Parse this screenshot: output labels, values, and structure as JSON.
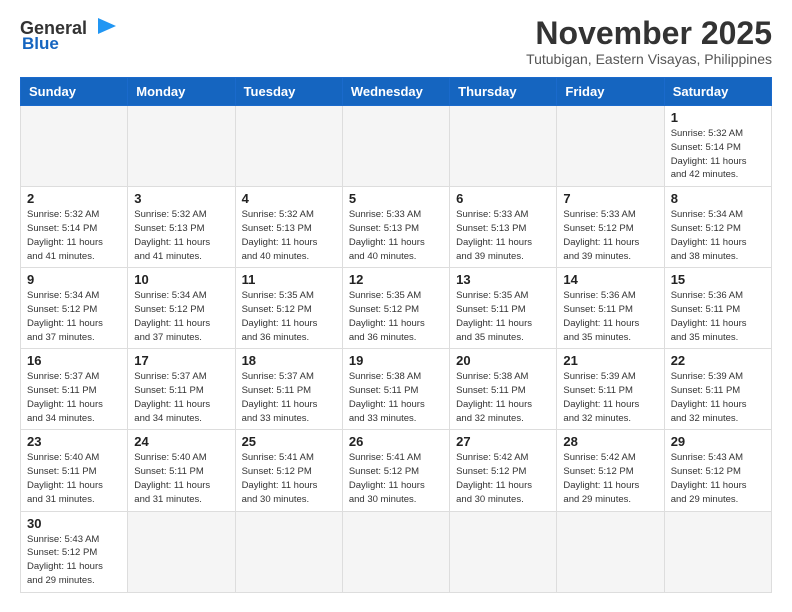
{
  "header": {
    "logo_line1": "General",
    "logo_line2": "Blue",
    "month": "November 2025",
    "location": "Tutubigan, Eastern Visayas, Philippines"
  },
  "days_of_week": [
    "Sunday",
    "Monday",
    "Tuesday",
    "Wednesday",
    "Thursday",
    "Friday",
    "Saturday"
  ],
  "weeks": [
    [
      {
        "day": "",
        "info": ""
      },
      {
        "day": "",
        "info": ""
      },
      {
        "day": "",
        "info": ""
      },
      {
        "day": "",
        "info": ""
      },
      {
        "day": "",
        "info": ""
      },
      {
        "day": "",
        "info": ""
      },
      {
        "day": "1",
        "info": "Sunrise: 5:32 AM\nSunset: 5:14 PM\nDaylight: 11 hours\nand 42 minutes."
      }
    ],
    [
      {
        "day": "2",
        "info": "Sunrise: 5:32 AM\nSunset: 5:14 PM\nDaylight: 11 hours\nand 41 minutes."
      },
      {
        "day": "3",
        "info": "Sunrise: 5:32 AM\nSunset: 5:13 PM\nDaylight: 11 hours\nand 41 minutes."
      },
      {
        "day": "4",
        "info": "Sunrise: 5:32 AM\nSunset: 5:13 PM\nDaylight: 11 hours\nand 40 minutes."
      },
      {
        "day": "5",
        "info": "Sunrise: 5:33 AM\nSunset: 5:13 PM\nDaylight: 11 hours\nand 40 minutes."
      },
      {
        "day": "6",
        "info": "Sunrise: 5:33 AM\nSunset: 5:13 PM\nDaylight: 11 hours\nand 39 minutes."
      },
      {
        "day": "7",
        "info": "Sunrise: 5:33 AM\nSunset: 5:12 PM\nDaylight: 11 hours\nand 39 minutes."
      },
      {
        "day": "8",
        "info": "Sunrise: 5:34 AM\nSunset: 5:12 PM\nDaylight: 11 hours\nand 38 minutes."
      }
    ],
    [
      {
        "day": "9",
        "info": "Sunrise: 5:34 AM\nSunset: 5:12 PM\nDaylight: 11 hours\nand 37 minutes."
      },
      {
        "day": "10",
        "info": "Sunrise: 5:34 AM\nSunset: 5:12 PM\nDaylight: 11 hours\nand 37 minutes."
      },
      {
        "day": "11",
        "info": "Sunrise: 5:35 AM\nSunset: 5:12 PM\nDaylight: 11 hours\nand 36 minutes."
      },
      {
        "day": "12",
        "info": "Sunrise: 5:35 AM\nSunset: 5:12 PM\nDaylight: 11 hours\nand 36 minutes."
      },
      {
        "day": "13",
        "info": "Sunrise: 5:35 AM\nSunset: 5:11 PM\nDaylight: 11 hours\nand 35 minutes."
      },
      {
        "day": "14",
        "info": "Sunrise: 5:36 AM\nSunset: 5:11 PM\nDaylight: 11 hours\nand 35 minutes."
      },
      {
        "day": "15",
        "info": "Sunrise: 5:36 AM\nSunset: 5:11 PM\nDaylight: 11 hours\nand 35 minutes."
      }
    ],
    [
      {
        "day": "16",
        "info": "Sunrise: 5:37 AM\nSunset: 5:11 PM\nDaylight: 11 hours\nand 34 minutes."
      },
      {
        "day": "17",
        "info": "Sunrise: 5:37 AM\nSunset: 5:11 PM\nDaylight: 11 hours\nand 34 minutes."
      },
      {
        "day": "18",
        "info": "Sunrise: 5:37 AM\nSunset: 5:11 PM\nDaylight: 11 hours\nand 33 minutes."
      },
      {
        "day": "19",
        "info": "Sunrise: 5:38 AM\nSunset: 5:11 PM\nDaylight: 11 hours\nand 33 minutes."
      },
      {
        "day": "20",
        "info": "Sunrise: 5:38 AM\nSunset: 5:11 PM\nDaylight: 11 hours\nand 32 minutes."
      },
      {
        "day": "21",
        "info": "Sunrise: 5:39 AM\nSunset: 5:11 PM\nDaylight: 11 hours\nand 32 minutes."
      },
      {
        "day": "22",
        "info": "Sunrise: 5:39 AM\nSunset: 5:11 PM\nDaylight: 11 hours\nand 32 minutes."
      }
    ],
    [
      {
        "day": "23",
        "info": "Sunrise: 5:40 AM\nSunset: 5:11 PM\nDaylight: 11 hours\nand 31 minutes."
      },
      {
        "day": "24",
        "info": "Sunrise: 5:40 AM\nSunset: 5:11 PM\nDaylight: 11 hours\nand 31 minutes."
      },
      {
        "day": "25",
        "info": "Sunrise: 5:41 AM\nSunset: 5:12 PM\nDaylight: 11 hours\nand 30 minutes."
      },
      {
        "day": "26",
        "info": "Sunrise: 5:41 AM\nSunset: 5:12 PM\nDaylight: 11 hours\nand 30 minutes."
      },
      {
        "day": "27",
        "info": "Sunrise: 5:42 AM\nSunset: 5:12 PM\nDaylight: 11 hours\nand 30 minutes."
      },
      {
        "day": "28",
        "info": "Sunrise: 5:42 AM\nSunset: 5:12 PM\nDaylight: 11 hours\nand 29 minutes."
      },
      {
        "day": "29",
        "info": "Sunrise: 5:43 AM\nSunset: 5:12 PM\nDaylight: 11 hours\nand 29 minutes."
      }
    ],
    [
      {
        "day": "30",
        "info": "Sunrise: 5:43 AM\nSunset: 5:12 PM\nDaylight: 11 hours\nand 29 minutes."
      },
      {
        "day": "",
        "info": ""
      },
      {
        "day": "",
        "info": ""
      },
      {
        "day": "",
        "info": ""
      },
      {
        "day": "",
        "info": ""
      },
      {
        "day": "",
        "info": ""
      },
      {
        "day": "",
        "info": ""
      }
    ]
  ]
}
